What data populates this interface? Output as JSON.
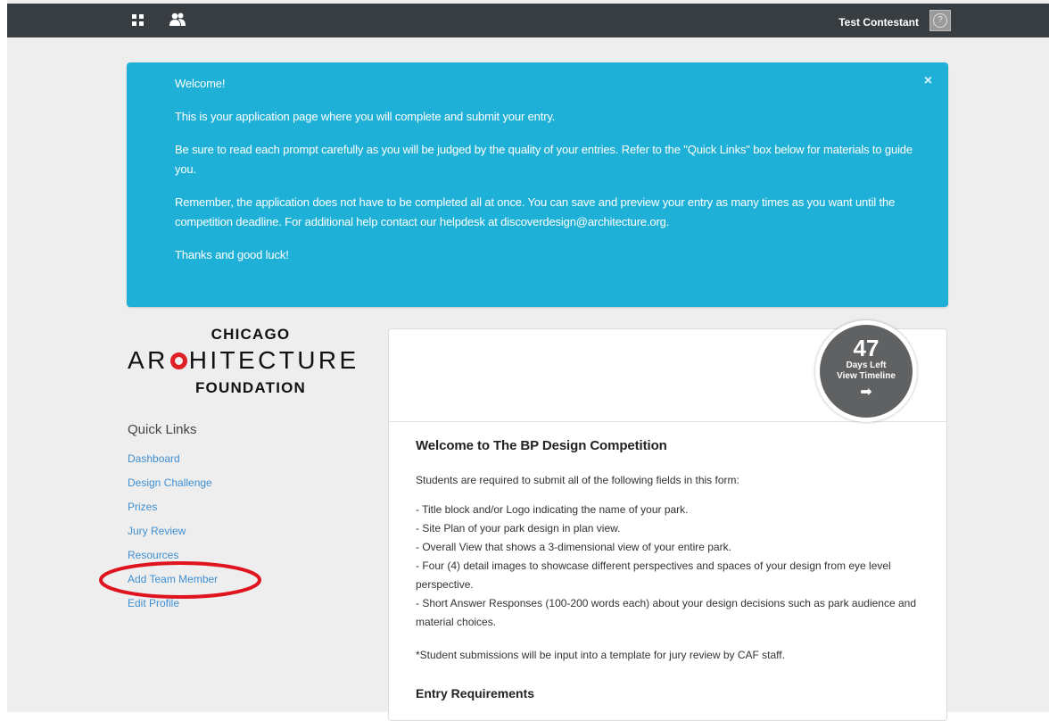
{
  "topbar": {
    "grid_icon": "grid-icon",
    "users_icon": "users-icon",
    "user_name": "Test Contestant",
    "help_label": "?"
  },
  "alert": {
    "paragraphs": [
      "Welcome!",
      "This is your application page where you will complete and submit your entry.",
      "Be sure to read each prompt carefully as you will be judged by the quality of your entries. Refer to the \"Quick Links\" box below for materials to guide you.",
      "Remember, the application does not have to be completed all at once. You can save and preview your entry as many times as you want until the competition deadline. For additional help contact our helpdesk at discoverdesign@architecture.org.",
      "Thanks and good luck!"
    ],
    "close_label": "×"
  },
  "logo": {
    "line1": "CHICAGO",
    "line2_pre": "AR",
    "line2_post": "HITECTURE",
    "line3": "FOUNDATION",
    "accent_color": "#e02027"
  },
  "quick_links": {
    "heading": "Quick Links",
    "items": [
      {
        "label": "Dashboard"
      },
      {
        "label": "Design Challenge"
      },
      {
        "label": "Prizes"
      },
      {
        "label": "Jury Review"
      },
      {
        "label": "Resources"
      },
      {
        "label": "Add Team Member"
      },
      {
        "label": "Edit Profile"
      }
    ]
  },
  "timeline": {
    "days": "47",
    "days_label": "Days Left",
    "link_label": "View Timeline",
    "arrow": "➡"
  },
  "content": {
    "title": "Welcome to The BP Design Competition",
    "intro": "Students are required to submit all of the following fields in this form:",
    "requirements": [
      "- Title block and/or Logo indicating the name of your park.",
      "- Site Plan of your park design in plan view.",
      "- Overall View that shows a 3-dimensional view of your entire park.",
      "- Four (4) detail images to showcase different perspectives and spaces of your design from eye level perspective.",
      "- Short Answer Responses (100-200 words each) about your design decisions such as park audience and material choices."
    ],
    "footnote": "*Student submissions will be input into a template for jury review by CAF staff.",
    "section_heading": "Entry Requirements"
  },
  "colors": {
    "topbar": "#383d42",
    "alert": "#1fb0d8",
    "link": "#3f8fd2",
    "highlight": "#e0141e"
  }
}
